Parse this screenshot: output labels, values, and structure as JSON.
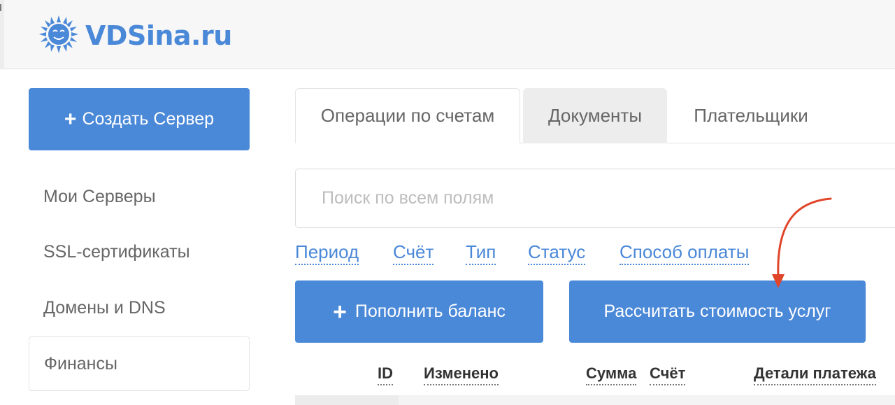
{
  "brand": {
    "name": "VDSina.ru",
    "logo_icon": "sun-icon",
    "color": "#4a88d8"
  },
  "sidebar": {
    "create_button": "Создать Сервер",
    "items": [
      {
        "label": "Мои Серверы"
      },
      {
        "label": "SSL-сертификаты"
      },
      {
        "label": "Домены и DNS"
      },
      {
        "label": "Финансы",
        "active": true
      }
    ]
  },
  "tabs": [
    {
      "label": "Операции по счетам",
      "active": true
    },
    {
      "label": "Документы"
    },
    {
      "label": "Плательщики"
    }
  ],
  "search": {
    "placeholder": "Поиск по всем полям",
    "value": ""
  },
  "filters": [
    "Период",
    "Счёт",
    "Тип",
    "Статус",
    "Способ оплаты"
  ],
  "actions": {
    "top_up": "Пополнить баланс",
    "calculate": "Рассчитать стоимость услуг"
  },
  "table": {
    "columns": [
      "ID",
      "Изменено",
      "Сумма",
      "Счёт",
      "Детали платежа"
    ]
  },
  "colors": {
    "accent": "#4a88d8",
    "annotation_arrow": "#e0452a"
  }
}
